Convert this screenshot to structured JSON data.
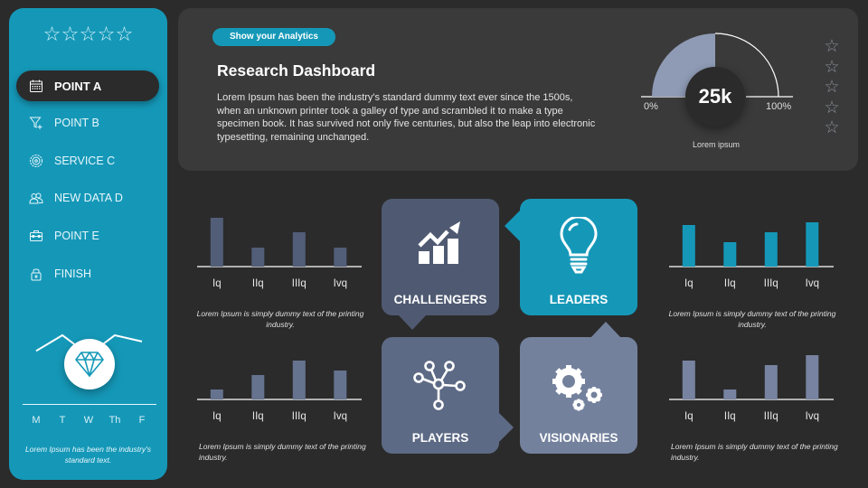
{
  "sidebar": {
    "rating_stars": 5,
    "star_glyph": "☆",
    "items": [
      {
        "label": "POINT A",
        "icon": "calendar-icon",
        "active": true
      },
      {
        "label": "POINT B",
        "icon": "funnel-plus-icon",
        "active": false
      },
      {
        "label": "SERVICE C",
        "icon": "gear-badge-icon",
        "active": false
      },
      {
        "label": "NEW DATA  D",
        "icon": "users-icon",
        "active": false
      },
      {
        "label": "POINT E",
        "icon": "toolbox-icon",
        "active": false
      },
      {
        "label": "FINISH",
        "icon": "lock-icon",
        "active": false
      }
    ],
    "week_chart": {
      "days": [
        "M",
        "T",
        "W",
        "Th",
        "F"
      ],
      "values": [
        1,
        3,
        0.5,
        3,
        2.2
      ],
      "center_icon": "diamond-icon"
    },
    "note": "Lorem Ipsum has been the industry's standard text."
  },
  "header": {
    "pill_label": "Show your Analytics",
    "title": "Research Dashboard",
    "description": "Lorem Ipsum has been the industry's standard  dummy text ever since the 1500s, when an unknown printer took a galley of type and scrambled it to make a  type specimen book. It  has survived not only five centuries, but also the leap into electronic typesetting, remaining unchanged.",
    "gauge": {
      "value_label": "25k",
      "fill_fraction": 0.5,
      "min_label": "0%",
      "max_label": "100%",
      "caption": "Lorem ipsum",
      "fill_color": "#8f9bb5"
    },
    "rating_stars": 5,
    "star_glyph": "☆"
  },
  "quadrants": [
    {
      "label": "CHALLENGERS",
      "icon": "growth-chart-icon",
      "color": "#4f5a72"
    },
    {
      "label": "LEADERS",
      "icon": "lightbulb-icon",
      "color": "#1598b8"
    },
    {
      "label": "PLAYERS",
      "icon": "network-icon",
      "color": "#5d6a85"
    },
    {
      "label": "VISIONARIES",
      "icon": "gears-icon",
      "color": "#74819d"
    }
  ],
  "chart_data": [
    {
      "type": "bar",
      "position": "top-left",
      "categories": [
        "Iq",
        "IIq",
        "IIIq",
        "Ivq"
      ],
      "values": [
        54,
        21,
        38,
        21
      ],
      "ylim": [
        0,
        60
      ],
      "color": "#525d78",
      "caption": "Lorem Ipsum is simply dummy text of the printing industry.",
      "caption_align": "center"
    },
    {
      "type": "bar",
      "position": "top-right",
      "categories": [
        "Iq",
        "IIq",
        "IIIq",
        "Ivq"
      ],
      "values": [
        46,
        27,
        38,
        49
      ],
      "ylim": [
        0,
        60
      ],
      "color": "#1598b8",
      "caption": "Lorem Ipsum is simply dummy text of the printing industry.",
      "caption_align": "center"
    },
    {
      "type": "bar",
      "position": "bottom-left",
      "categories": [
        "Iq",
        "IIq",
        "IIIq",
        "Ivq"
      ],
      "values": [
        11,
        27,
        43,
        32
      ],
      "ylim": [
        0,
        60
      ],
      "color": "#66738f",
      "caption": "Lorem Ipsum is simply dummy text of the printing industry.",
      "caption_align": "left"
    },
    {
      "type": "bar",
      "position": "bottom-right",
      "categories": [
        "Iq",
        "IIq",
        "IIIq",
        "Ivq"
      ],
      "values": [
        43,
        11,
        38,
        49
      ],
      "ylim": [
        0,
        60
      ],
      "color": "#7783a0",
      "caption": "Lorem Ipsum is simply dummy text of the printing industry.",
      "caption_align": "left"
    }
  ]
}
